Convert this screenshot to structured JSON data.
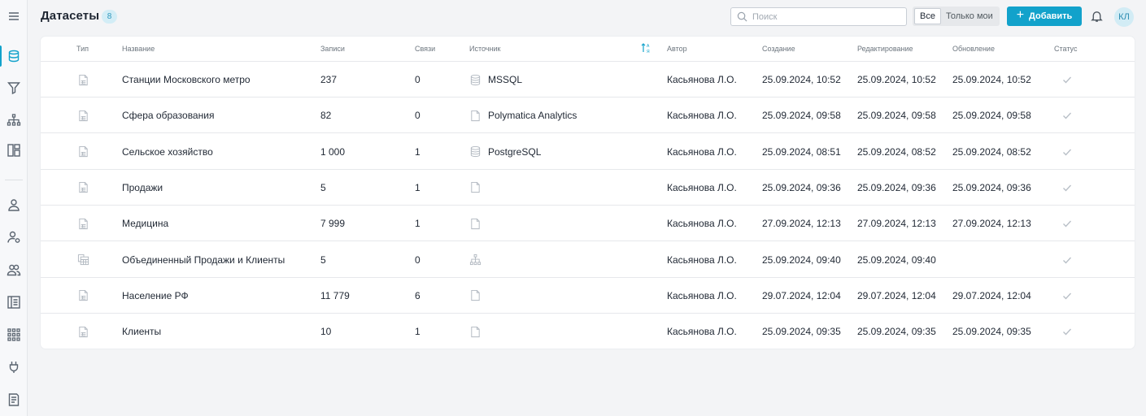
{
  "header": {
    "title": "Датасеты",
    "count": "8",
    "search_placeholder": "Поиск",
    "filter_all": "Все",
    "filter_mine": "Только мои",
    "add_label": "Добавить",
    "avatar_initials": "КЛ"
  },
  "sidebar": {
    "items": [
      {
        "name": "menu-icon"
      },
      {
        "name": "datasets-icon",
        "active": true
      },
      {
        "name": "filter-icon"
      },
      {
        "name": "hierarchy-icon"
      },
      {
        "name": "dashboards-icon"
      },
      {
        "name": "user-icon"
      },
      {
        "name": "user-settings-icon"
      },
      {
        "name": "users-icon"
      },
      {
        "name": "catalog-icon"
      },
      {
        "name": "apps-grid-icon"
      },
      {
        "name": "plug-icon"
      },
      {
        "name": "logs-icon"
      }
    ]
  },
  "table": {
    "columns": {
      "type": "Тип",
      "name": "Название",
      "records": "Записи",
      "links": "Связи",
      "source": "Источник",
      "author": "Автор",
      "created": "Создание",
      "edited": "Редактирование",
      "updated": "Обновление",
      "status": "Статус"
    },
    "rows": [
      {
        "type_icon": "file-icon",
        "name": "Станции Московского метро",
        "records": "237",
        "links": "0",
        "source_icon": "database-icon",
        "source": "MSSQL",
        "author": "Касьянова Л.О.",
        "created": "25.09.2024, 10:52",
        "edited": "25.09.2024, 10:52",
        "updated": "25.09.2024, 10:52"
      },
      {
        "type_icon": "file-icon",
        "name": "Сфера образования",
        "records": "82",
        "links": "0",
        "source_icon": "file-outline-icon",
        "source": "Polymatica Analytics",
        "author": "Касьянова Л.О.",
        "created": "25.09.2024, 09:58",
        "edited": "25.09.2024, 09:58",
        "updated": "25.09.2024, 09:58"
      },
      {
        "type_icon": "file-icon",
        "name": "Сельское хозяйство",
        "records": "1 000",
        "links": "1",
        "source_icon": "database-icon",
        "source": "PostgreSQL",
        "author": "Касьянова Л.О.",
        "created": "25.09.2024, 08:51",
        "edited": "25.09.2024, 08:52",
        "updated": "25.09.2024, 08:52"
      },
      {
        "type_icon": "file-icon",
        "name": "Продажи",
        "records": "5",
        "links": "1",
        "source_icon": "file-outline-icon",
        "source": "",
        "author": "Касьянова Л.О.",
        "created": "25.09.2024, 09:36",
        "edited": "25.09.2024, 09:36",
        "updated": "25.09.2024, 09:36"
      },
      {
        "type_icon": "file-icon",
        "name": "Медицина",
        "records": "7 999",
        "links": "1",
        "source_icon": "file-outline-icon",
        "source": "",
        "author": "Касьянова Л.О.",
        "created": "27.09.2024, 12:13",
        "edited": "27.09.2024, 12:13",
        "updated": "27.09.2024, 12:13"
      },
      {
        "type_icon": "merged-icon",
        "name": "Объединенный Продажи и Клиенты",
        "records": "5",
        "links": "0",
        "source_icon": "hierarchy-icon",
        "source": "",
        "author": "Касьянова Л.О.",
        "created": "25.09.2024, 09:40",
        "edited": "25.09.2024, 09:40",
        "updated": ""
      },
      {
        "type_icon": "file-icon",
        "name": "Население РФ",
        "records": "11 779",
        "links": "6",
        "source_icon": "file-outline-icon",
        "source": "",
        "author": "Касьянова Л.О.",
        "created": "29.07.2024, 12:04",
        "edited": "29.07.2024, 12:04",
        "updated": "29.07.2024, 12:04"
      },
      {
        "type_icon": "file-icon",
        "name": "Клиенты",
        "records": "10",
        "links": "1",
        "source_icon": "file-outline-icon",
        "source": "",
        "author": "Касьянова Л.О.",
        "created": "25.09.2024, 09:35",
        "edited": "25.09.2024, 09:35",
        "updated": "25.09.2024, 09:35"
      }
    ]
  },
  "colors": {
    "accent": "#12a2cb",
    "icon_muted": "#b1b8c0"
  }
}
